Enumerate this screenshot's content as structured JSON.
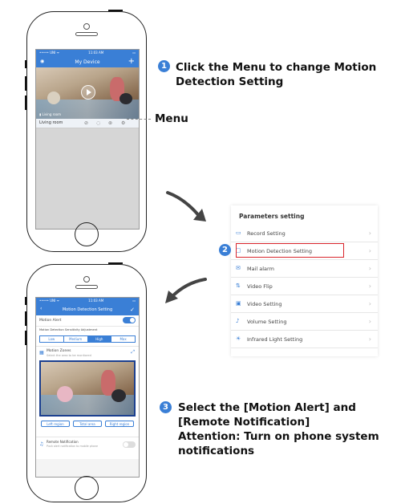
{
  "steps": {
    "step1": {
      "number": "1",
      "line1": "Click the Menu to change Motion",
      "line2": "Detection Setting"
    },
    "step2": {
      "number": "2"
    },
    "step3": {
      "number": "3",
      "line1": "Select the [Motion Alert] and",
      "line2": "[Remote Notification]",
      "line3": "Attention: Turn on phone system",
      "line4": "notifications"
    }
  },
  "menu_label": "Menu",
  "phone1": {
    "status_left": "••••• UNI  ᯤ",
    "status_center": "11:03 AM",
    "status_right": "▭",
    "nav_title": "My Device",
    "nav_add": "+",
    "camera_status": "▮ Living room",
    "device_name": "Living room",
    "icons": [
      "alarm-icon",
      "record-icon",
      "playback-icon",
      "settings-icon"
    ]
  },
  "settings_panel": {
    "title": "Parameters setting",
    "items": [
      {
        "label": "Record Setting",
        "icon": "record-icon"
      },
      {
        "label": "Motion Detection Setting",
        "icon": "motion-icon"
      },
      {
        "label": "Mail alarm",
        "icon": "mail-icon"
      },
      {
        "label": "Video Flip",
        "icon": "flip-icon"
      },
      {
        "label": "Video Setting",
        "icon": "video-icon"
      },
      {
        "label": "Volume Setting",
        "icon": "volume-icon"
      },
      {
        "label": "Infrared Light Setting",
        "icon": "infrared-icon"
      }
    ],
    "chevron": "›"
  },
  "phone2": {
    "status_left": "••••• UNI  ᯤ",
    "status_center": "11:03 AM",
    "status_right": "▭",
    "nav_back": "‹",
    "nav_title": "Motion Detection Setting",
    "nav_done": "✓",
    "motion_alert_label": "Motion Alert",
    "motion_alert_on": true,
    "sensitivity_label": "Motion Detection Sensitivity Adjustment",
    "sensitivity_options": [
      "Low",
      "Medium",
      "High",
      "Max"
    ],
    "sensitivity_selected": 2,
    "zones_label": "Motion Zones",
    "zones_sub": "Select the area to be monitored",
    "zone_buttons": [
      "Left region",
      "Total area",
      "Right region"
    ],
    "remote_label": "Remote Notification",
    "remote_sub": "Push alert notification to mobile phone",
    "remote_on": false
  },
  "colors": {
    "accent": "#3a7fd6",
    "highlight": "#d9242b"
  }
}
